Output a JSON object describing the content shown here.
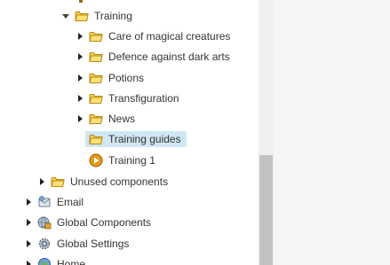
{
  "tree": {
    "nodes": [
      {
        "label": "Training",
        "icon": "folder-icon",
        "expanded": true
      },
      {
        "label": "Care of magical creatures",
        "icon": "folder-icon",
        "expanded": false
      },
      {
        "label": "Defence against dark arts",
        "icon": "folder-icon",
        "expanded": false
      },
      {
        "label": "Potions",
        "icon": "folder-icon",
        "expanded": false
      },
      {
        "label": "Transfiguration",
        "icon": "folder-icon",
        "expanded": false
      },
      {
        "label": "News",
        "icon": "folder-icon",
        "expanded": false
      },
      {
        "label": "Training guides",
        "icon": "folder-icon",
        "selected": true
      },
      {
        "label": "Training 1",
        "icon": "play-circle-icon"
      },
      {
        "label": "Unused components",
        "icon": "folder-icon",
        "expanded": false
      },
      {
        "label": "Email",
        "icon": "email-icon",
        "expanded": false
      },
      {
        "label": "Global Components",
        "icon": "global-components-icon",
        "expanded": false
      },
      {
        "label": "Global Settings",
        "icon": "gear-icon",
        "expanded": false
      },
      {
        "label": "Home",
        "icon": "globe-icon",
        "expanded": false
      }
    ]
  },
  "colors": {
    "folder": "#f5c518",
    "selection": "#cfe7f2",
    "scroll_thumb": "#c2c2c2"
  }
}
